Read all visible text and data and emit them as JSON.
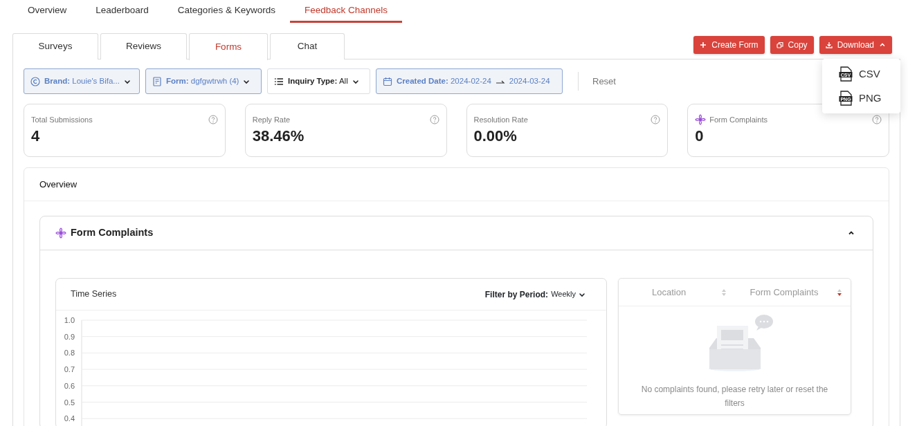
{
  "top_tabs": [
    {
      "label": "Overview",
      "selected": false
    },
    {
      "label": "Leaderboard",
      "selected": false
    },
    {
      "label": "Categories & Keywords",
      "selected": false
    },
    {
      "label": "Feedback Channels",
      "selected": true
    }
  ],
  "channel_tabs": [
    {
      "label": "Surveys",
      "selected": false
    },
    {
      "label": "Reviews",
      "selected": false
    },
    {
      "label": "Forms",
      "selected": true
    },
    {
      "label": "Chat",
      "selected": false
    }
  ],
  "actions": [
    {
      "label": "Create Form",
      "kind": "plus"
    },
    {
      "label": "Copy",
      "kind": "copy"
    },
    {
      "label": "Download",
      "kind": "download",
      "expanded": true
    }
  ],
  "download_menu": [
    {
      "label": "CSV",
      "badge": "CSV"
    },
    {
      "label": "PNG",
      "badge": "PNG"
    }
  ],
  "filters": [
    {
      "kind": "select",
      "label": "Brand:",
      "value": "Louie's Bifa...",
      "applied": true
    },
    {
      "kind": "select",
      "label": "Form:",
      "value": "dgfgwtrwh (4)",
      "applied": true
    },
    {
      "kind": "select",
      "label": "Inquiry Type:",
      "value": "All",
      "applied": false
    },
    {
      "kind": "daterange",
      "label": "Created Date:",
      "from": "2024-02-24",
      "to": "2024-03-24",
      "applied": true
    }
  ],
  "reset": "Reset",
  "kpis": [
    {
      "title": "Total Submissions",
      "value": "4",
      "flower": false
    },
    {
      "title": "Reply Rate",
      "value": "38.46%",
      "flower": false
    },
    {
      "title": "Resolution Rate",
      "value": "0.00%",
      "flower": false
    },
    {
      "title": "Form Complaints",
      "value": "0",
      "flower": true
    }
  ],
  "overview": {
    "title": "Overview",
    "section": {
      "title": "Form Complaints",
      "expanded": true,
      "time_series": {
        "title": "Time Series",
        "filter_label": "Filter by Period:",
        "filter_value": "Weekly",
        "y_axis_labels": [
          "1.0",
          "0.9",
          "0.8",
          "0.7",
          "0.6",
          "0.5",
          "0.4"
        ]
      },
      "table": {
        "columns": [
          {
            "label": "Location",
            "sorted": false
          },
          {
            "label": "Form Complaints",
            "sorted": true
          }
        ],
        "empty_message": "No complaints found, please retry later or reset the filters"
      }
    }
  }
}
